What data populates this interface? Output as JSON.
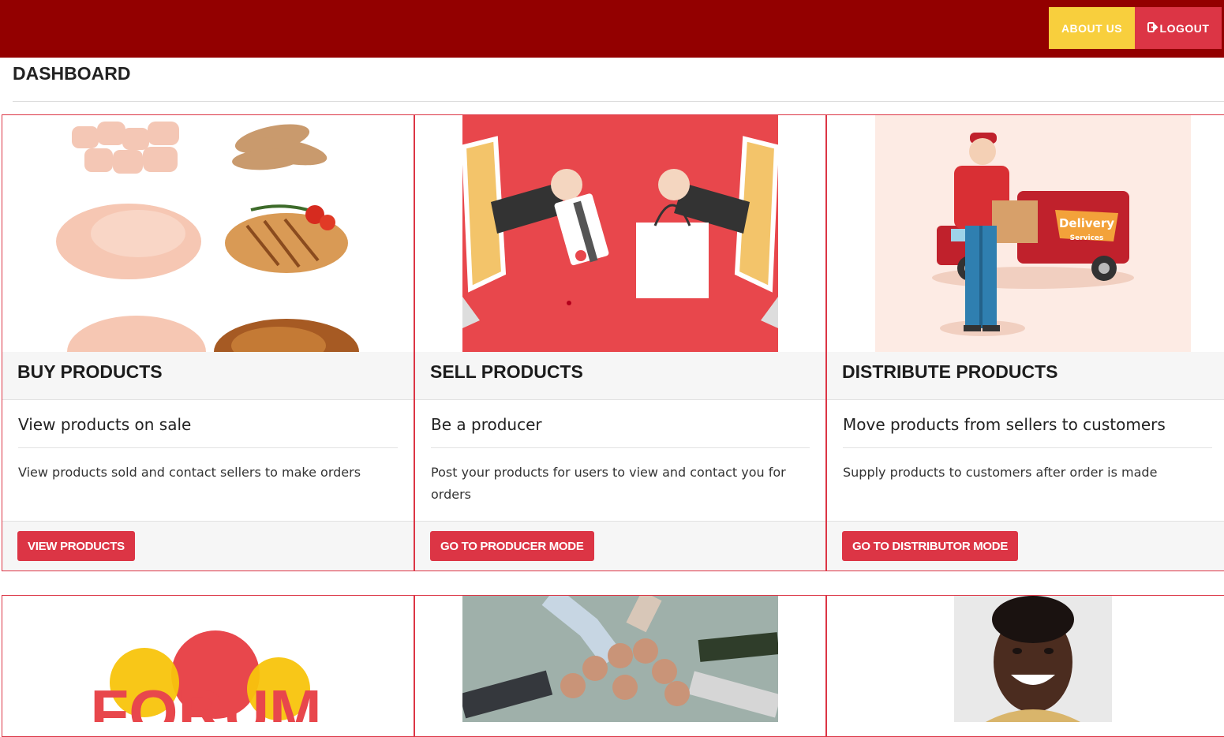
{
  "header": {
    "about_label": "ABOUT US",
    "logout_label": "LOGOUT",
    "logout_icon": "sign-out-icon",
    "bar_color": "#930000"
  },
  "page": {
    "title": "DASHBOARD"
  },
  "cards": [
    {
      "title": "BUY PRODUCTS",
      "subtitle": "View products on sale",
      "text": "View products sold and contact sellers to make orders",
      "button": "VIEW PRODUCTS",
      "image": "chicken-meat-photo"
    },
    {
      "title": "SELL PRODUCTS",
      "subtitle": "Be a producer",
      "text": "Post your products for users to view and contact you for orders",
      "button": "GO TO PRODUCER MODE",
      "image": "online-shopping-illustration"
    },
    {
      "title": "DISTRIBUTE PRODUCTS",
      "subtitle": "Move products from sellers to customers",
      "text": "Supply products to customers after order is made",
      "button": "GO TO DISTRIBUTOR MODE",
      "image": "delivery-services-illustration",
      "image_text": {
        "line1": "Delivery",
        "line2": "Services"
      }
    }
  ],
  "row2_cards": [
    {
      "image": "forum-logo",
      "image_text": "FORUM"
    },
    {
      "image": "team-fist-bump-photo"
    },
    {
      "image": "person-portrait-photo"
    }
  ],
  "colors": {
    "accent": "#dc3545",
    "about_button": "#f8cf3d",
    "header": "#930000"
  }
}
